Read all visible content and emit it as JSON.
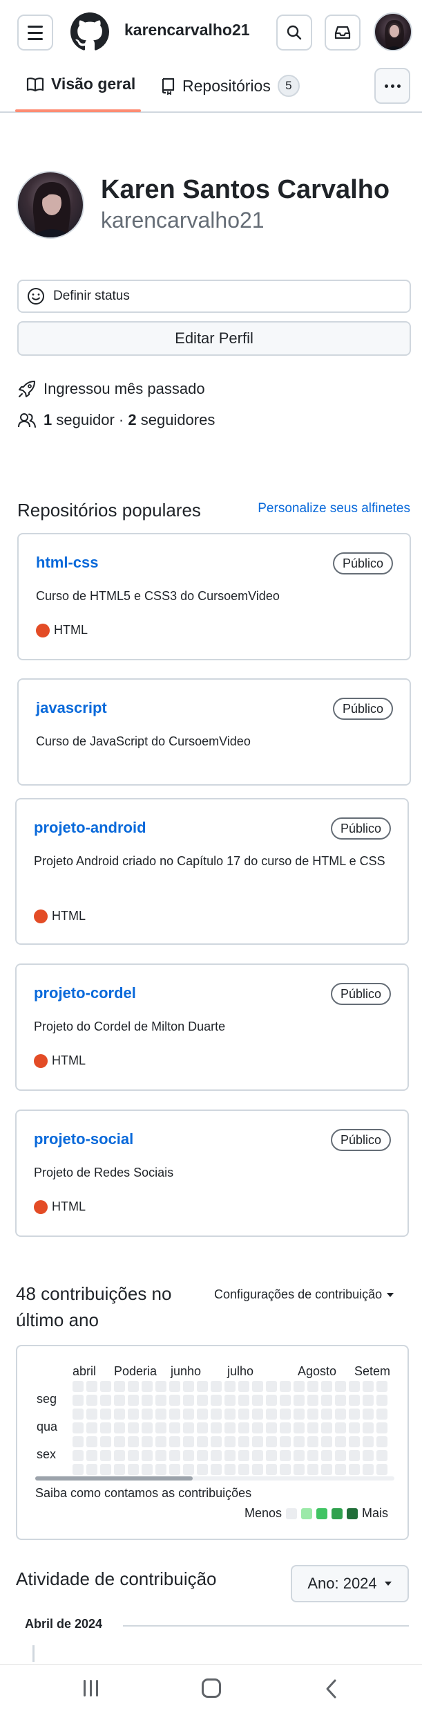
{
  "header": {
    "username": "karencarvalho21",
    "icons": [
      "menu-icon",
      "github-logo",
      "search-icon",
      "inbox-icon",
      "avatar"
    ]
  },
  "tabs": [
    {
      "label": "Visão geral",
      "icon": "book-icon",
      "active": true
    },
    {
      "label": "Repositórios",
      "icon": "repo-icon",
      "count": "5",
      "active": false
    }
  ],
  "profile": {
    "fullname": "Karen Santos Carvalho",
    "login": "karencarvalho21",
    "status_label": "Definir status",
    "edit_label": "Editar Perfil",
    "joined": "Ingressou mês passado",
    "followers_count": "1",
    "followers_label": "seguidor",
    "following_count": "2",
    "following_label": "seguidores",
    "separator": "·"
  },
  "popular": {
    "title": "Repositórios populares",
    "customize": "Personalize seus alfinetes",
    "repos": [
      {
        "name": "html-css",
        "visibility": "Público",
        "description": "Curso de HTML5 e CSS3 do CursoemVideo",
        "language": "HTML"
      },
      {
        "name": "javascript",
        "visibility": "Público",
        "description": "Curso de JavaScript do CursoemVideo",
        "language": ""
      },
      {
        "name": "projeto-android",
        "visibility": "Público",
        "description": "Projeto Android criado no Capítulo 17 do curso de HTML e CSS",
        "language": "HTML"
      },
      {
        "name": "projeto-cordel",
        "visibility": "Público",
        "description": "Projeto do Cordel de Milton Duarte",
        "language": "HTML"
      },
      {
        "name": "projeto-social",
        "visibility": "Público",
        "description": "Projeto de Redes Sociais",
        "language": "HTML"
      }
    ],
    "language_color": "#e34c26"
  },
  "contributions": {
    "title": "48 contribuições no último ano",
    "settings": "Configurações de contribuição",
    "months": [
      "abril",
      "Poderia",
      "junho",
      "julho",
      "Agosto",
      "Setem"
    ],
    "days": [
      "seg",
      "qua",
      "sex"
    ],
    "learn": "Saiba como contamos as contribuições",
    "legend_less": "Menos",
    "legend_more": "Mais",
    "legend_colors": [
      "#ebedf0",
      "#9be9a8",
      "#40c463",
      "#30a14e",
      "#216e39"
    ]
  },
  "activity": {
    "title": "Atividade de contribuição",
    "year_button": "Ano: 2024",
    "month_heading": "Abril de 2024"
  },
  "android_nav": [
    "recents-icon",
    "home-icon",
    "back-icon"
  ]
}
